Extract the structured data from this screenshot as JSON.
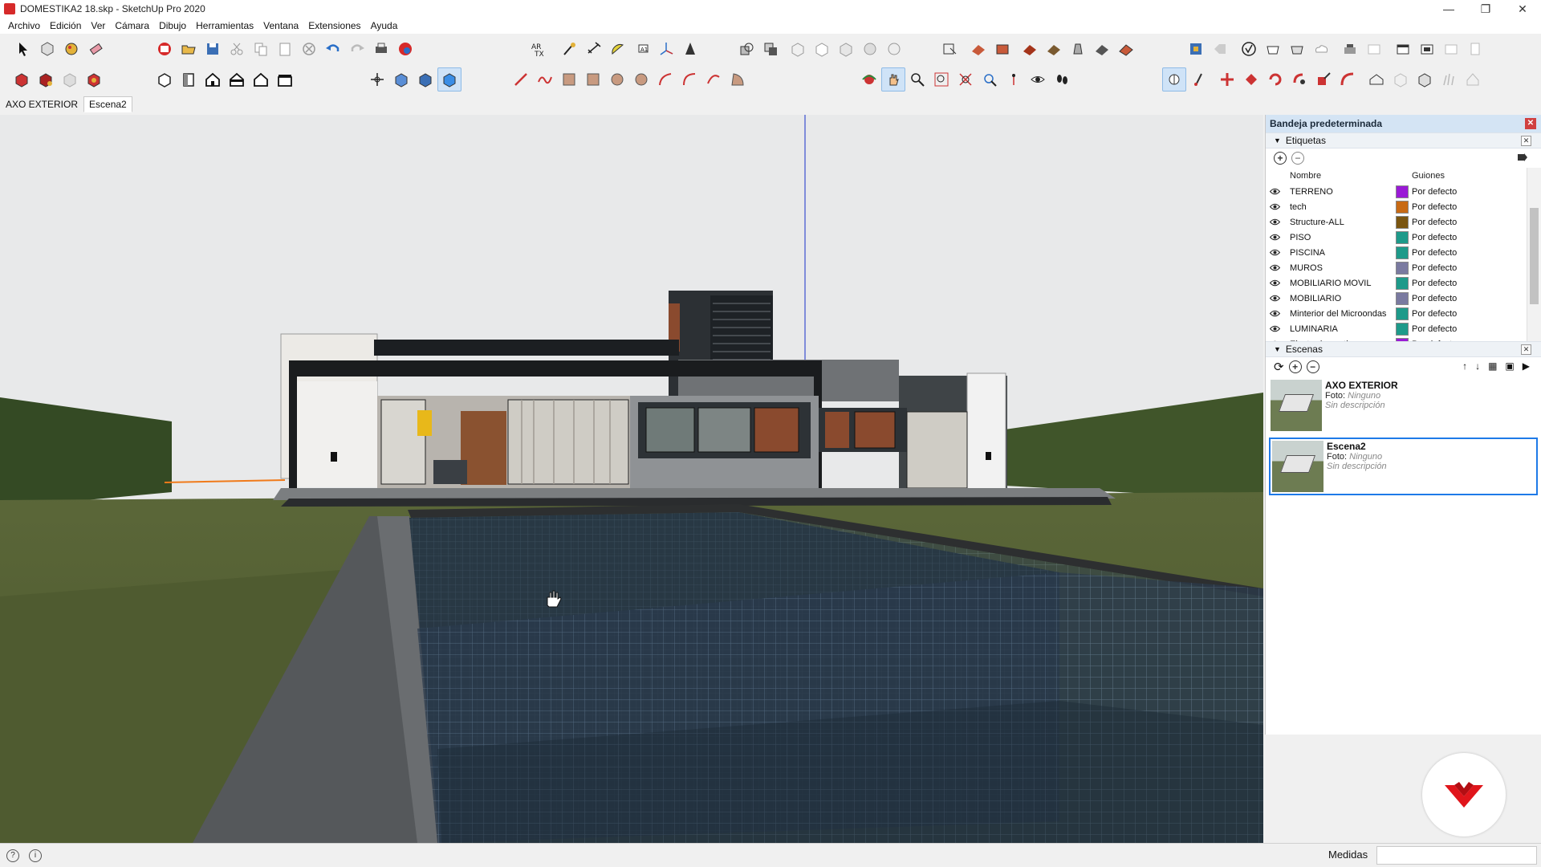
{
  "window": {
    "title": "DOMESTIKA2 18.skp - SketchUp Pro 2020",
    "buttons": [
      "—",
      "❐",
      "✕"
    ]
  },
  "menu": [
    "Archivo",
    "Edición",
    "Ver",
    "Cámara",
    "Dibujo",
    "Herramientas",
    "Ventana",
    "Extensiones",
    "Ayuda"
  ],
  "scene_tabs": [
    {
      "label": "AXO EXTERIOR",
      "active": false
    },
    {
      "label": "Escena2",
      "active": true
    }
  ],
  "tray": {
    "title": "Bandeja predeterminada",
    "tags_panel": {
      "title": "Etiquetas",
      "col_name": "Nombre",
      "col_dashes": "Guiones",
      "rows": [
        {
          "name": "TERRENO",
          "color": "#9a1ad6",
          "dash": "Por defecto"
        },
        {
          "name": "tech",
          "color": "#c86a14",
          "dash": "Por defecto"
        },
        {
          "name": "Structure-ALL",
          "color": "#7a5510",
          "dash": "Por defecto"
        },
        {
          "name": "PISO",
          "color": "#1e9a8a",
          "dash": "Por defecto"
        },
        {
          "name": "PISCINA",
          "color": "#1e9a8a",
          "dash": "Por defecto"
        },
        {
          "name": "MUROS",
          "color": "#7a7aa0",
          "dash": "Por defecto"
        },
        {
          "name": "MOBILIARIO MOVIL",
          "color": "#1e9a8a",
          "dash": "Por defecto"
        },
        {
          "name": "MOBILIARIO",
          "color": "#7a7aa0",
          "dash": "Por defecto"
        },
        {
          "name": "Minterior del Microondas",
          "color": "#1e9a8a",
          "dash": "Por defecto"
        },
        {
          "name": "LUMINARIA",
          "color": "#1e9a8a",
          "dash": "Por defecto"
        },
        {
          "name": "Electrodomesticos",
          "color": "#9a1ad6",
          "dash": "Por defecto"
        }
      ]
    },
    "scenes_panel": {
      "title": "Escenas",
      "items": [
        {
          "name": "AXO EXTERIOR",
          "foto_label": "Foto:",
          "foto": "Ninguno",
          "desc": "Sin descripción",
          "selected": false
        },
        {
          "name": "Escena2",
          "foto_label": "Foto:",
          "foto": "Ninguno",
          "desc": "Sin descripción",
          "selected": true
        }
      ]
    }
  },
  "status": {
    "measure_label": "Medidas",
    "measure_value": ""
  },
  "colors": {
    "accent": "#1e7ae8",
    "brand": "#e0151b",
    "sky": "#e8e9ea",
    "grass": "#4d5a2c",
    "pool": "#243444"
  }
}
